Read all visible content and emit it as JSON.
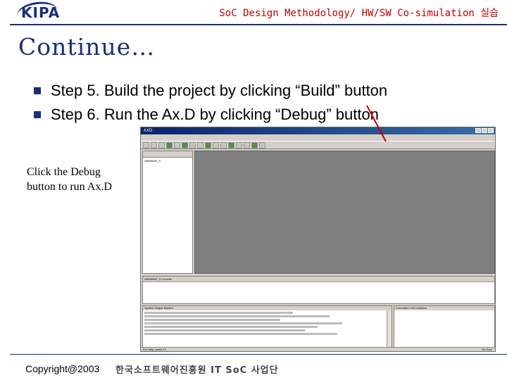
{
  "header": {
    "logo": "KIPA",
    "title": "SoC Design Methodology/ HW/SW Co-simulation 실습"
  },
  "slide": {
    "title": "Continue…",
    "bullets": [
      "Step 5. Build the project by clicking “Build” button",
      "Step 6. Run the Ax.D by clicking “Debug” button"
    ],
    "caption_line1": "Click the Debug",
    "caption_line2": "button to run Ax.D"
  },
  "ide": {
    "window_title": "AXD",
    "tree_item": "ARM966E_S",
    "build_panel": "ARM966E_S   Console",
    "output_title": "System Output Monitor",
    "console_title": "Command Line Interface",
    "status_left": "For Help, press F1",
    "status_right": "No Proc"
  },
  "footer": {
    "copyright": "Copyright@2003",
    "org": "한국소프트웨어진흥원 IT SoC 사업단"
  },
  "colors": {
    "accent": "#1a2f7a",
    "header_text": "#c00000",
    "callout": "#c00000"
  }
}
